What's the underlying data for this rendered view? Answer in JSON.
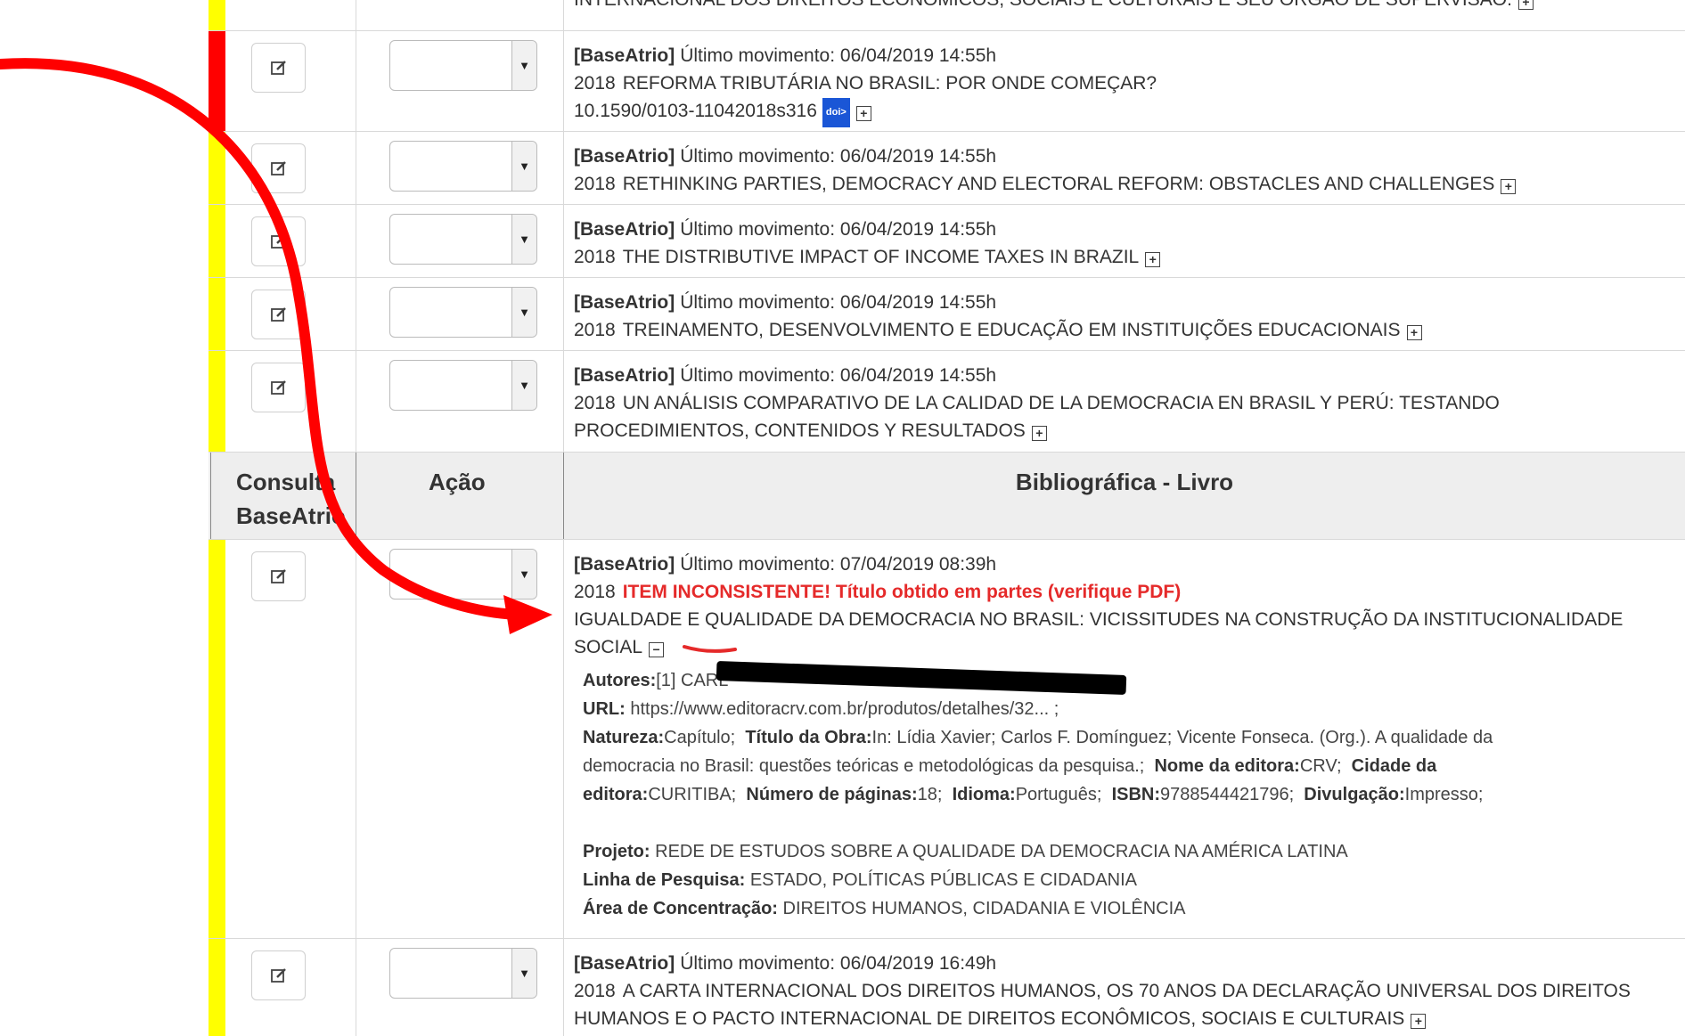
{
  "colors": {
    "red_strip": "#ff0000",
    "yellow_strip": "#ffff00",
    "warning": "#e52a2a",
    "arrow": "#ff0000",
    "doi_badge": "#1a56d6"
  },
  "top_partial": "INTERNACIONAL DOS DIREITOS ECONÔMICOS, SOCIAIS E CULTURAIS E SEU ÓRGÃO DE SUPERVISÃO.",
  "rows": [
    {
      "source": "[BaseAtrio]",
      "movement": "Último movimento: 06/04/2019 14:55h",
      "year": "2018",
      "title": "REFORMA TRIBUTÁRIA NO BRASIL: POR ONDE COMEÇAR?",
      "doi": "10.1590/0103-11042018s316",
      "doi_badge": "doi>"
    },
    {
      "source": "[BaseAtrio]",
      "movement": "Último movimento: 06/04/2019 14:55h",
      "year": "2018",
      "title": "RETHINKING PARTIES, DEMOCRACY AND ELECTORAL REFORM: OBSTACLES AND CHALLENGES"
    },
    {
      "source": "[BaseAtrio]",
      "movement": "Último movimento: 06/04/2019 14:55h",
      "year": "2018",
      "title": "THE DISTRIBUTIVE IMPACT OF INCOME TAXES IN BRAZIL"
    },
    {
      "source": "[BaseAtrio]",
      "movement": "Último movimento: 06/04/2019 14:55h",
      "year": "2018",
      "title": "TREINAMENTO, DESENVOLVIMENTO E EDUCAÇÃO EM INSTITUIÇÕES EDUCACIONAIS"
    },
    {
      "source": "[BaseAtrio]",
      "movement": "Último movimento: 06/04/2019 14:55h",
      "year": "2018",
      "title_line1": "UN ANÁLISIS COMPARATIVO DE LA CALIDAD DE LA DEMOCRACIA EN BRASIL Y PERÚ: TESTANDO",
      "title_line2": "PROCEDIMIENTOS, CONTENIDOS Y RESULTADOS"
    }
  ],
  "header": {
    "col1_line1": "Consulta",
    "col1_line2": "BaseAtrio",
    "col2": "Ação",
    "col3": "Bibliográfica - Livro"
  },
  "expanded": {
    "source": "[BaseAtrio]",
    "movement": "Último movimento: 07/04/2019 08:39h",
    "year": "2018",
    "warning": "ITEM INCONSISTENTE! Título obtido em partes (verifique PDF)",
    "title_line1": "IGUALDADE E QUALIDADE DA DEMOCRACIA NO BRASIL: VICISSITUDES NA CONSTRUÇÃO DA INSTITUCIONALIDADE",
    "title_line2": "SOCIAL",
    "autores_label": "Autores:",
    "autores_value": "[1] CARL",
    "url_label": "URL:",
    "url_value": "https://www.editoracrv.com.br/produtos/detalhes/32... ;",
    "natureza_label": "Natureza:",
    "natureza_value": "Capítulo;",
    "titulo_obra_label": "Título da Obra:",
    "titulo_obra_value_l1": "In: Lídia Xavier; Carlos F. Domínguez; Vicente Fonseca. (Org.). A qualidade da",
    "titulo_obra_value_l2": "democracia no Brasil: questões teóricas e metodológicas da pesquisa.;",
    "editora_label": "Nome da editora:",
    "editora_value": "CRV;",
    "cidade_label_l1": "Cidade da",
    "cidade_label_l2": "editora:",
    "cidade_value": "CURITIBA;",
    "paginas_label": "Número de páginas:",
    "paginas_value": "18;",
    "idioma_label": "Idioma:",
    "idioma_value": "Português;",
    "isbn_label": "ISBN:",
    "isbn_value": "9788544421796;",
    "divulgacao_label": "Divulgação:",
    "divulgacao_value": "Impresso;",
    "projeto_label": "Projeto:",
    "projeto_value": "REDE DE ESTUDOS SOBRE A QUALIDADE DA DEMOCRACIA NA AMÉRICA LATINA",
    "linha_label": "Linha de Pesquisa:",
    "linha_value": "ESTADO, POLÍTICAS PÚBLICAS E CIDADANIA",
    "area_label": "Área de Concentração:",
    "area_value": "DIREITOS HUMANOS, CIDADANIA E VIOLÊNCIA"
  },
  "last_row": {
    "source": "[BaseAtrio]",
    "movement": "Último movimento: 06/04/2019 16:49h",
    "year": "2018",
    "title_line1": "A CARTA INTERNACIONAL DOS DIREITOS HUMANOS, OS 70 ANOS DA DECLARAÇÃO UNIVERSAL DOS DIREITOS",
    "title_line2": "HUMANOS E O PACTO INTERNACIONAL DE DIREITOS ECONÔMICOS, SOCIAIS E CULTURAIS"
  },
  "icons": {
    "edit": "edit-icon",
    "dropdown": "chevron-down-icon",
    "expand": "plus-box-icon",
    "collapse": "minus-box-icon"
  }
}
